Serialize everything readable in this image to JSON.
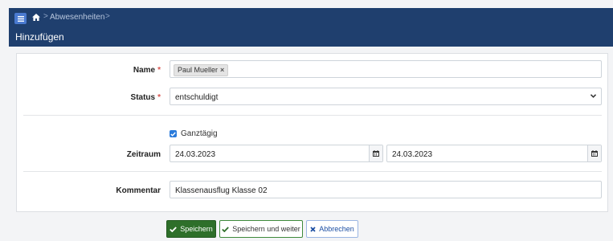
{
  "breadcrumb": {
    "current": "Abwesenheiten",
    "separator": ">"
  },
  "page_title": "Hinzufügen",
  "form": {
    "name": {
      "label": "Name",
      "required_mark": "*",
      "tags": [
        "Paul Mueller"
      ],
      "tag_remove": "×"
    },
    "status": {
      "label": "Status",
      "required_mark": "*",
      "value": "entschuldigt"
    },
    "all_day": {
      "label": "Ganztägig",
      "checked": true
    },
    "period": {
      "label": "Zeitraum",
      "from": "24.03.2023",
      "to": "24.03.2023"
    },
    "comment": {
      "label": "Kommentar",
      "value": "Klassenausflug Klasse 02"
    }
  },
  "buttons": {
    "save": "Speichern",
    "save_continue": "Speichern und weiter",
    "cancel": "Abbrechen"
  },
  "colors": {
    "header_bg": "#1f3f6e",
    "save_bg": "#2e6f2a",
    "checkbox": "#2b7bdb",
    "required": "#d9534f"
  },
  "icons": {
    "menu": "hamburger-menu-icon",
    "home": "home-icon",
    "select": "chevron-down-icon",
    "calendar": "calendar-icon",
    "check": "check-icon",
    "cancel": "close-icon"
  }
}
